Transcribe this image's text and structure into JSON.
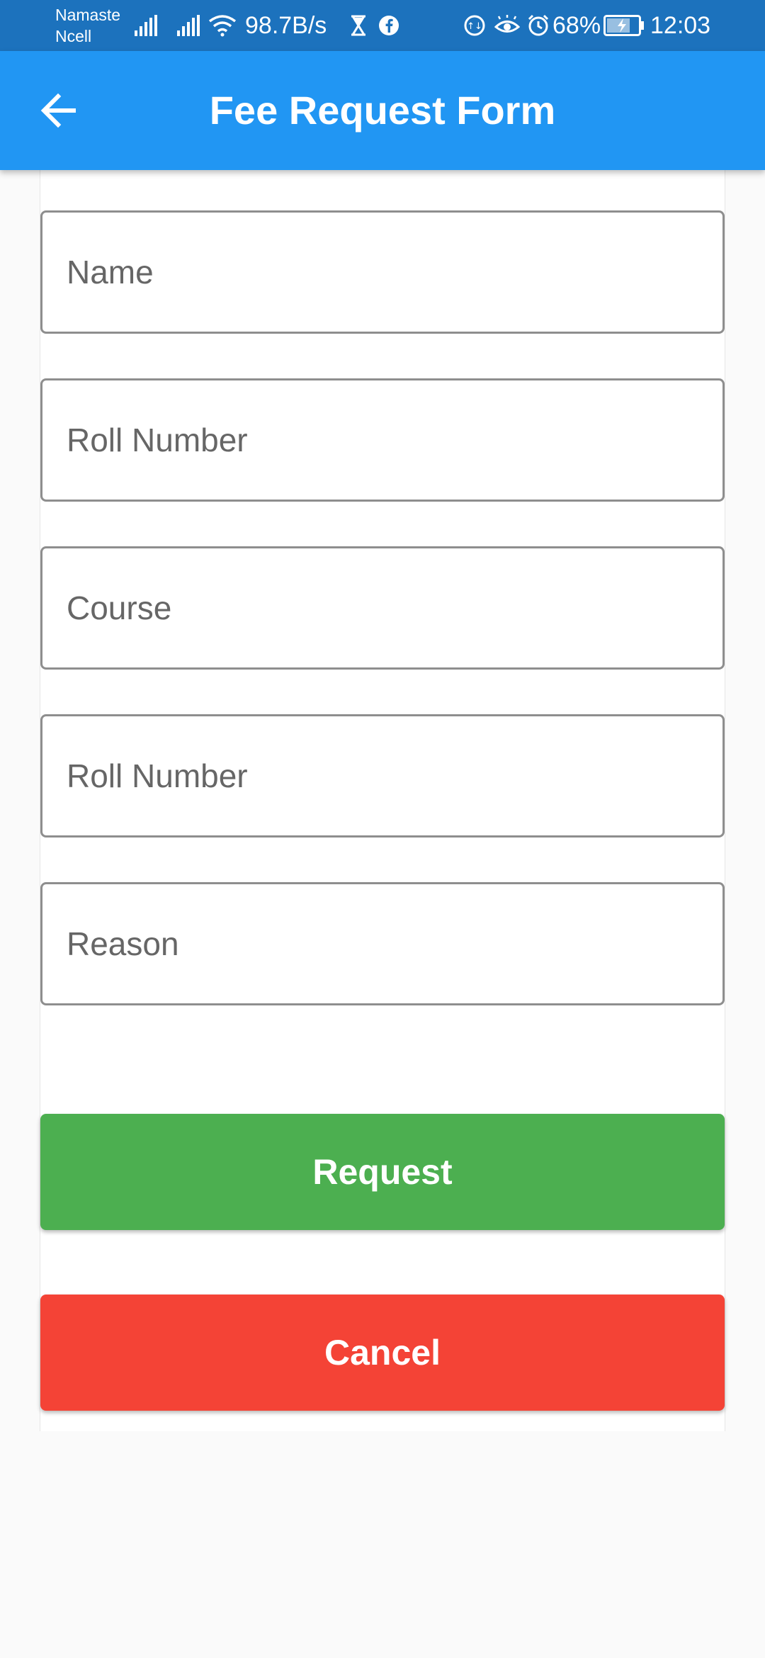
{
  "status_bar": {
    "carrier_line1": "Namaste",
    "carrier_line2": "Ncell",
    "network_speed": "98.7B/s",
    "battery": "68%",
    "time": "12:03",
    "icons": [
      "signal-icon",
      "signal-icon",
      "wifi-icon",
      "hourglass-icon",
      "facebook-icon",
      "data-saver-icon",
      "eye-comfort-icon",
      "alarm-icon",
      "battery-charging-icon"
    ]
  },
  "app_bar": {
    "title": "Fee Request Form",
    "back_icon": "arrow-left-icon",
    "color": "#2196f3"
  },
  "form": {
    "fields": [
      {
        "placeholder": "Name",
        "value": ""
      },
      {
        "placeholder": "Roll Number",
        "value": ""
      },
      {
        "placeholder": "Course",
        "value": ""
      },
      {
        "placeholder": "Roll Number",
        "value": ""
      },
      {
        "placeholder": "Reason",
        "value": ""
      }
    ],
    "request_label": "Request",
    "cancel_label": "Cancel",
    "request_color": "#4caf50",
    "cancel_color": "#f44336"
  }
}
